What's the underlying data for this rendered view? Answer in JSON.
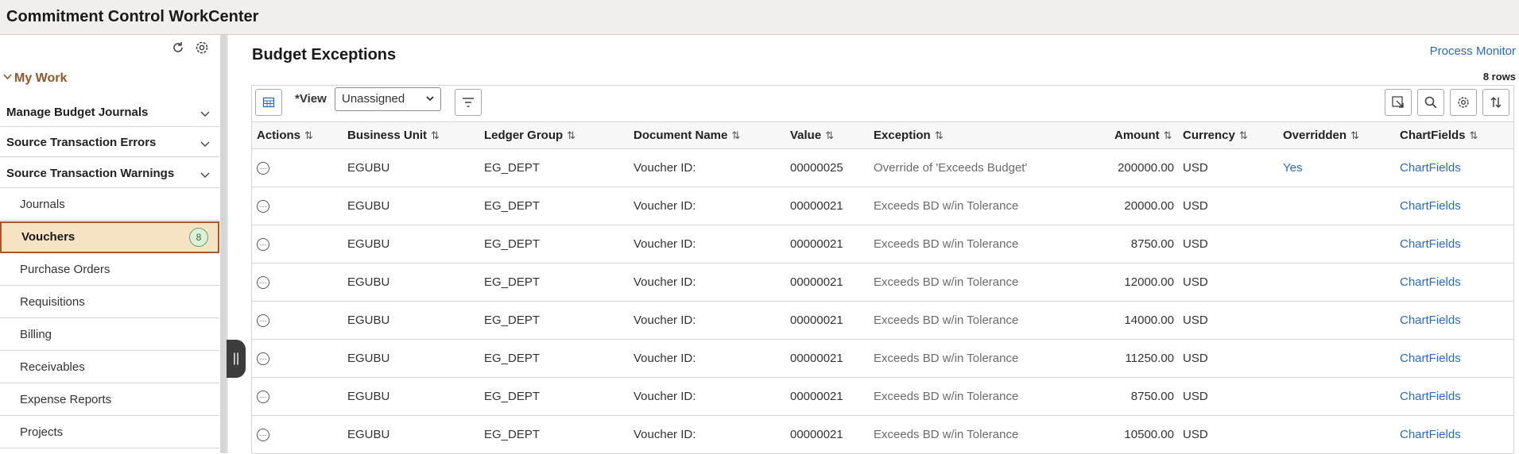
{
  "app": {
    "title": "Commitment Control WorkCenter"
  },
  "sidebar": {
    "section_label": "My Work",
    "groups": [
      {
        "label": "Manage Budget Journals"
      },
      {
        "label": "Source Transaction Errors"
      },
      {
        "label": "Source Transaction Warnings"
      }
    ],
    "items": [
      {
        "label": "Journals"
      },
      {
        "label": "Vouchers",
        "badge": "8"
      },
      {
        "label": "Purchase Orders"
      },
      {
        "label": "Requisitions"
      },
      {
        "label": "Billing"
      },
      {
        "label": "Receivables"
      },
      {
        "label": "Expense Reports"
      },
      {
        "label": "Projects"
      }
    ],
    "handle_glyph": "||"
  },
  "main": {
    "title": "Budget Exceptions",
    "process_monitor_link": "Process Monitor",
    "row_count": "8 rows",
    "view_label": "*View",
    "view_value": "Unassigned",
    "columns": [
      "Actions",
      "Business Unit",
      "Ledger Group",
      "Document Name",
      "Value",
      "Exception",
      "Amount",
      "Currency",
      "Overridden",
      "ChartFields"
    ],
    "sort_glyph": "⇅",
    "rows": [
      {
        "business_unit": "EGUBU",
        "ledger_group": "EG_DEPT",
        "document_name": "Voucher ID:",
        "value": "00000025",
        "exception": "Override of 'Exceeds Budget'",
        "amount": "200000.00",
        "currency": "USD",
        "overridden": "Yes",
        "chartfields": "ChartFields"
      },
      {
        "business_unit": "EGUBU",
        "ledger_group": "EG_DEPT",
        "document_name": "Voucher ID:",
        "value": "00000021",
        "exception": "Exceeds BD w/in Tolerance",
        "amount": "20000.00",
        "currency": "USD",
        "overridden": "",
        "chartfields": "ChartFields"
      },
      {
        "business_unit": "EGUBU",
        "ledger_group": "EG_DEPT",
        "document_name": "Voucher ID:",
        "value": "00000021",
        "exception": "Exceeds BD w/in Tolerance",
        "amount": "8750.00",
        "currency": "USD",
        "overridden": "",
        "chartfields": "ChartFields"
      },
      {
        "business_unit": "EGUBU",
        "ledger_group": "EG_DEPT",
        "document_name": "Voucher ID:",
        "value": "00000021",
        "exception": "Exceeds BD w/in Tolerance",
        "amount": "12000.00",
        "currency": "USD",
        "overridden": "",
        "chartfields": "ChartFields"
      },
      {
        "business_unit": "EGUBU",
        "ledger_group": "EG_DEPT",
        "document_name": "Voucher ID:",
        "value": "00000021",
        "exception": "Exceeds BD w/in Tolerance",
        "amount": "14000.00",
        "currency": "USD",
        "overridden": "",
        "chartfields": "ChartFields"
      },
      {
        "business_unit": "EGUBU",
        "ledger_group": "EG_DEPT",
        "document_name": "Voucher ID:",
        "value": "00000021",
        "exception": "Exceeds BD w/in Tolerance",
        "amount": "11250.00",
        "currency": "USD",
        "overridden": "",
        "chartfields": "ChartFields"
      },
      {
        "business_unit": "EGUBU",
        "ledger_group": "EG_DEPT",
        "document_name": "Voucher ID:",
        "value": "00000021",
        "exception": "Exceeds BD w/in Tolerance",
        "amount": "8750.00",
        "currency": "USD",
        "overridden": "",
        "chartfields": "ChartFields"
      },
      {
        "business_unit": "EGUBU",
        "ledger_group": "EG_DEPT",
        "document_name": "Voucher ID:",
        "value": "00000021",
        "exception": "Exceeds BD w/in Tolerance",
        "amount": "10500.00",
        "currency": "USD",
        "overridden": "",
        "chartfields": "ChartFields"
      }
    ]
  },
  "icons": {
    "refresh": "refresh-icon",
    "settings": "gear-icon",
    "export": "export-icon",
    "filter": "filter-icon",
    "search": "search-icon",
    "sort": "sort-icon",
    "actions": "ellipsis-icon"
  },
  "colors": {
    "active_item_bg": "#f5e3c4",
    "active_item_border": "#a05a2c",
    "link": "#2a6bbf",
    "section_label": "#8b5a2b"
  }
}
